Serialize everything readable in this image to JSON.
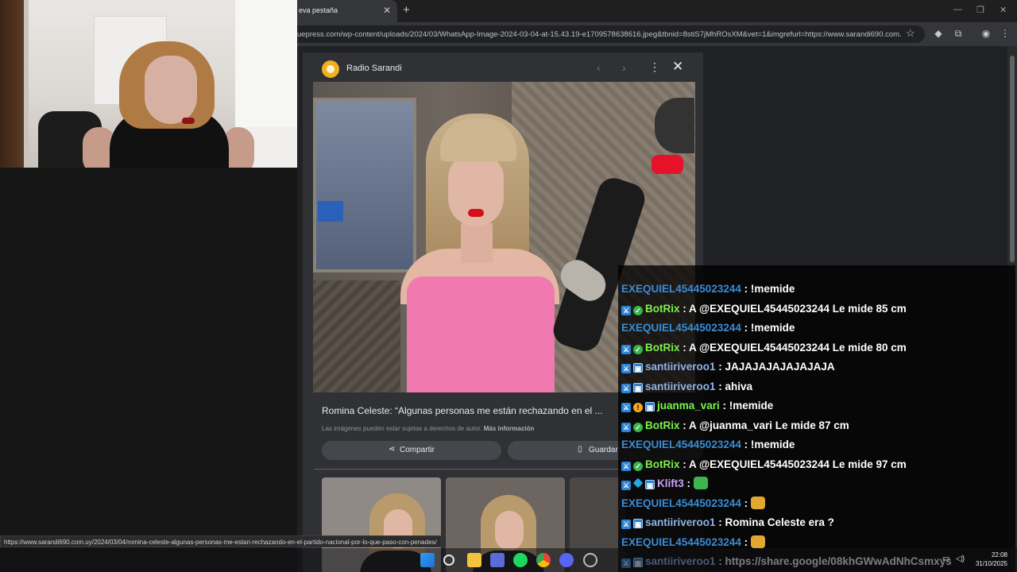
{
  "browser": {
    "tab_title": "eva pestaña",
    "url": "uepress.com/wp-content/uploads/2024/03/WhatsApp-Image-2024-03-04-at-15.43.19-e1709578638616.jpeg&tbnid=8stiS7jMhROsXM&vet=1&imgrefurl=https://www.sarandi690.com...",
    "status_url": "https://www.sarandi690.com.uy/2024/03/04/romina-celeste-algunas-personas-me-estan-rechazando-en-el-partido-nacional-por-lo-que-paso-con-penades/"
  },
  "viewer": {
    "source": "Radio Sarandi",
    "title": "Romina Celeste: “Algunas personas me están rechazando en el ...",
    "copyright": "Las imágenes pueden estar sujetas a derechos de autor.",
    "more_info": "Más información",
    "share_label": "Compartir",
    "save_label": "Guardar"
  },
  "chat": {
    "messages": [
      {
        "user": "EXEQUIEL45445023244",
        "color": "#3b8bd4",
        "badges": [],
        "text": "!memide"
      },
      {
        "user": "BotRix",
        "color": "#7cf24a",
        "badges": [
          "mod",
          "check"
        ],
        "text": "A @EXEQUIEL45445023244 Le mide 85 cm"
      },
      {
        "user": "EXEQUIEL45445023244",
        "color": "#3b8bd4",
        "badges": [],
        "text": "!memide"
      },
      {
        "user": "BotRix",
        "color": "#7cf24a",
        "badges": [
          "mod",
          "check"
        ],
        "text": "A @EXEQUIEL45445023244 Le mide 80 cm"
      },
      {
        "user": "santiiriveroo1",
        "color": "#8fb4e6",
        "badges": [
          "mod",
          "sub"
        ],
        "text": "JAJAJAJAJAJAJAJA"
      },
      {
        "user": "santiiriveroo1",
        "color": "#8fb4e6",
        "badges": [
          "mod",
          "sub"
        ],
        "text": "ahiva"
      },
      {
        "user": "juanma_vari",
        "color": "#7cf24a",
        "badges": [
          "mod",
          "og",
          "sub"
        ],
        "text": "!memide"
      },
      {
        "user": "BotRix",
        "color": "#7cf24a",
        "badges": [
          "mod",
          "check"
        ],
        "text": "A @juanma_vari Le mide 87 cm"
      },
      {
        "user": "EXEQUIEL45445023244",
        "color": "#3b8bd4",
        "badges": [],
        "text": "!memide"
      },
      {
        "user": "BotRix",
        "color": "#7cf24a",
        "badges": [
          "mod",
          "check"
        ],
        "text": "A @EXEQUIEL45445023244 Le mide 97 cm"
      },
      {
        "user": "Klift3",
        "color": "#c9a2f5",
        "badges": [
          "mod",
          "cube",
          "sub"
        ],
        "text": "",
        "emote": "#3fb34f"
      },
      {
        "user": "EXEQUIEL45445023244",
        "color": "#3b8bd4",
        "badges": [],
        "text": "",
        "emote": "#e0a830"
      },
      {
        "user": "santiiriveroo1",
        "color": "#8fb4e6",
        "badges": [
          "mod",
          "sub"
        ],
        "text": "Romina Celeste era ?"
      },
      {
        "user": "EXEQUIEL45445023244",
        "color": "#3b8bd4",
        "badges": [],
        "text": "",
        "emote": "#e0a830"
      },
      {
        "user": "santiiriveroo1",
        "color": "#8fb4e6",
        "badges": [
          "mod",
          "sub"
        ],
        "text": "https://share.google/08khGWwAdNhCsmxys"
      }
    ]
  },
  "taskbar": {
    "time": "22:08",
    "date": "31/10/2025"
  },
  "colors": {
    "accent_green": "#7cf24a",
    "accent_blue": "#3b8bd4",
    "panel": "#303134"
  }
}
